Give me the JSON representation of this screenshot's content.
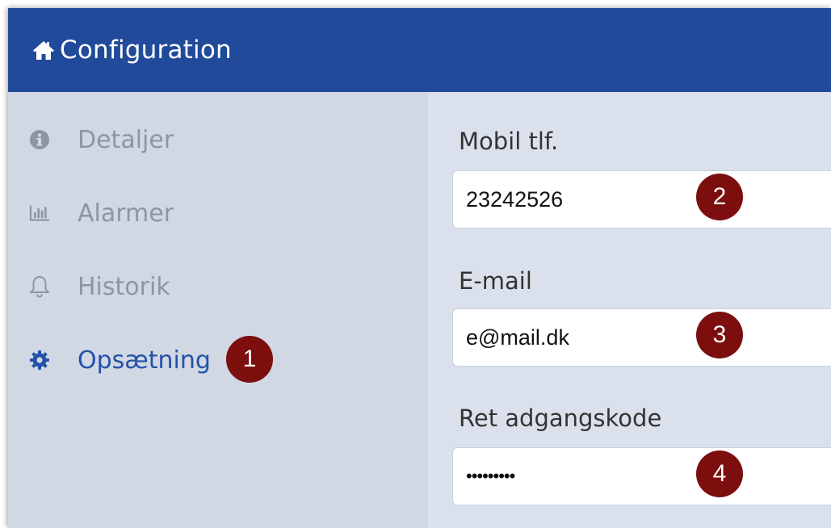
{
  "header": {
    "title": "Configuration",
    "icon": "home-icon",
    "background": "#214a9a"
  },
  "sidebar": {
    "items": [
      {
        "label": "Detaljer",
        "icon": "info-icon",
        "active": false
      },
      {
        "label": "Alarmer",
        "icon": "bar-chart-icon",
        "active": false
      },
      {
        "label": "Historik",
        "icon": "bell-icon",
        "active": false
      },
      {
        "label": "Opsætning",
        "icon": "gear-icon",
        "active": true
      }
    ]
  },
  "form": {
    "mobile": {
      "label": "Mobil tlf.",
      "value": "23242526"
    },
    "email": {
      "label": "E-mail",
      "value": "e@mail.dk"
    },
    "password": {
      "label": "Ret adgangskode",
      "value": "•••••••••"
    }
  },
  "badges": [
    "1",
    "2",
    "3",
    "4"
  ],
  "colors": {
    "accent": "#2352a8",
    "muted": "#8d96a3",
    "badge": "#7d0e0e",
    "sidebar_bg": "#d1d7e3",
    "content_bg": "#dbe1ec"
  }
}
